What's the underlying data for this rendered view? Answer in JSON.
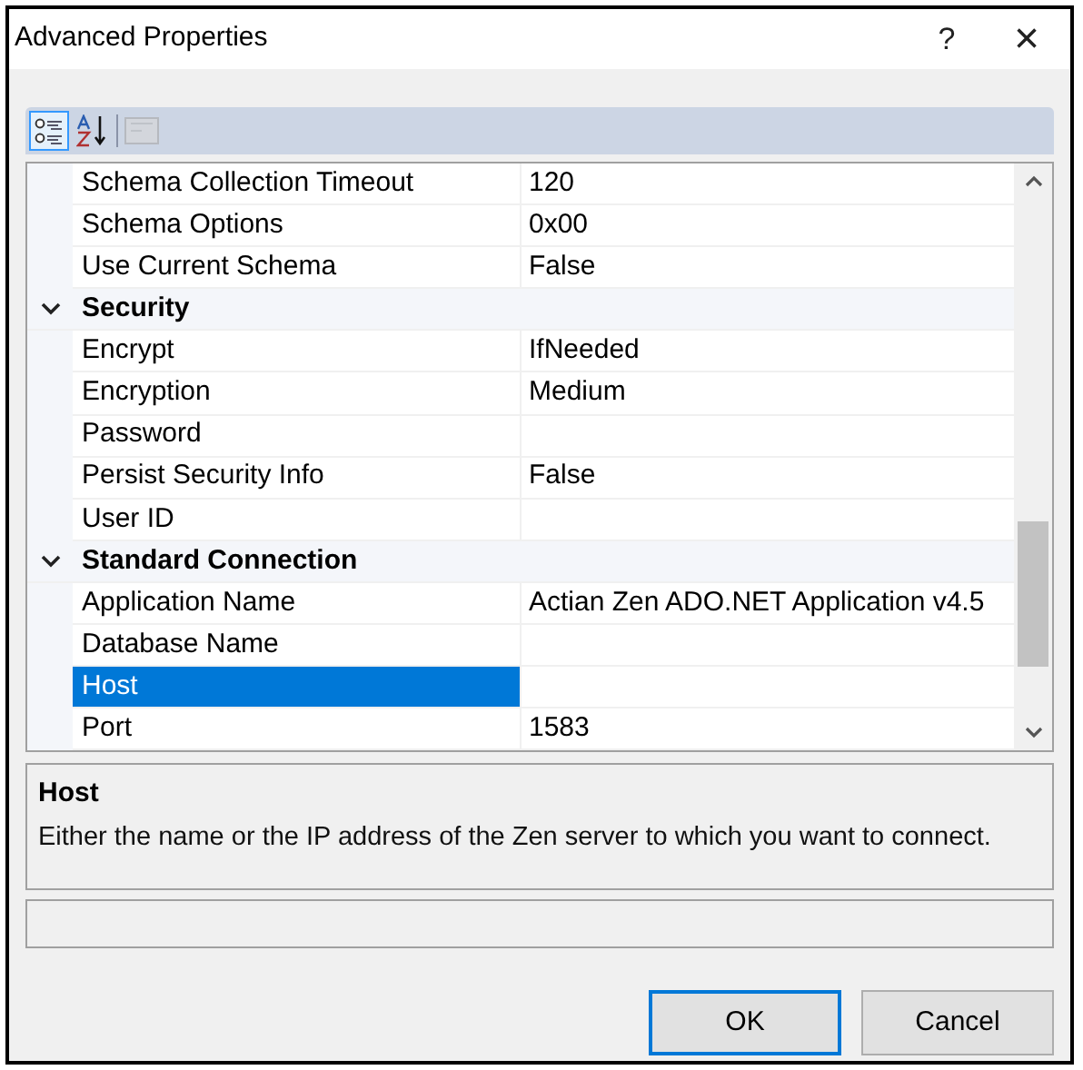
{
  "window": {
    "title": "Advanced Properties",
    "help": "?",
    "close": "×"
  },
  "toolbar": {
    "buttons": [
      {
        "kind": "categorized",
        "selected": true,
        "disabled": false
      },
      {
        "kind": "alphabetical",
        "selected": false,
        "disabled": false
      },
      {
        "kind": "pages",
        "selected": false,
        "disabled": true
      }
    ]
  },
  "grid": {
    "rows": [
      {
        "kind": "property",
        "name": "Schema Collection Timeout",
        "value": "120",
        "selected": false
      },
      {
        "kind": "property",
        "name": "Schema Options",
        "value": "0x00",
        "selected": false
      },
      {
        "kind": "property",
        "name": "Use Current Schema",
        "value": "False",
        "selected": false
      },
      {
        "kind": "category",
        "name": "Security",
        "expanded": true
      },
      {
        "kind": "property",
        "name": "Encrypt",
        "value": "IfNeeded",
        "selected": false
      },
      {
        "kind": "property",
        "name": "Encryption",
        "value": "Medium",
        "selected": false
      },
      {
        "kind": "property",
        "name": "Password",
        "value": "",
        "selected": false
      },
      {
        "kind": "property",
        "name": "Persist Security Info",
        "value": "False",
        "selected": false
      },
      {
        "kind": "property",
        "name": "User ID",
        "value": "",
        "selected": false
      },
      {
        "kind": "category",
        "name": "Standard Connection",
        "expanded": true
      },
      {
        "kind": "property",
        "name": "Application Name",
        "value": "Actian Zen ADO.NET Application v4.5",
        "selected": false
      },
      {
        "kind": "property",
        "name": "Database Name",
        "value": "",
        "selected": false
      },
      {
        "kind": "property",
        "name": "Host",
        "value": "",
        "selected": true
      },
      {
        "kind": "property",
        "name": "Port",
        "value": "1583",
        "selected": false
      }
    ]
  },
  "description": {
    "title": "Host",
    "text": "Either the name or the IP address of the Zen server to which you want to connect."
  },
  "buttons": [
    {
      "label": "OK",
      "default": true
    },
    {
      "label": "Cancel",
      "default": false
    }
  ]
}
